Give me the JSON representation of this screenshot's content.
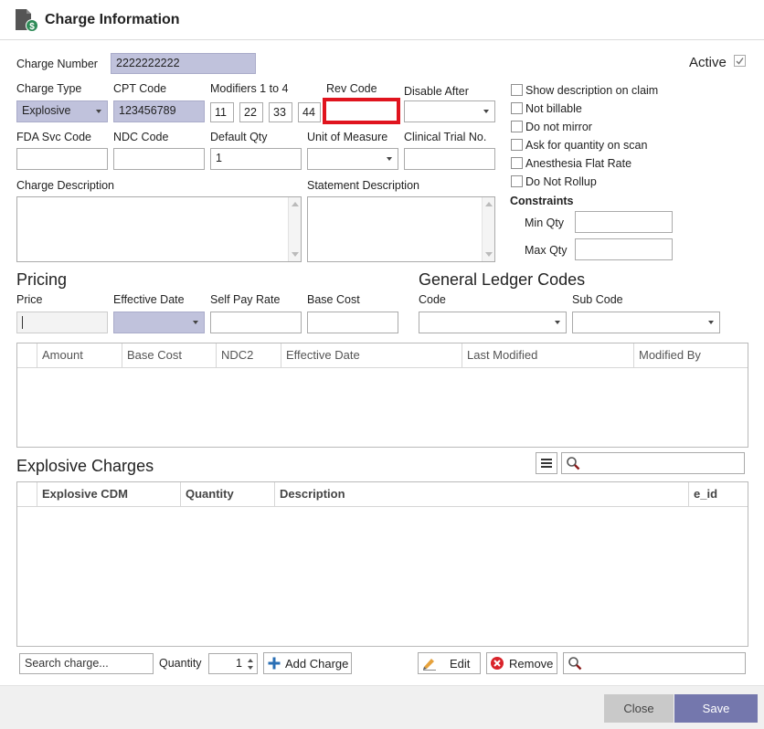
{
  "window": {
    "title": "Charge Information",
    "icon": "document-dollar-icon"
  },
  "active": {
    "label": "Active",
    "checked": true
  },
  "fields": {
    "charge_number": {
      "label": "Charge Number",
      "value": "2222222222"
    },
    "charge_type": {
      "label": "Charge Type",
      "value": "Explosive"
    },
    "cpt_code": {
      "label": "CPT Code",
      "value": "123456789"
    },
    "modifiers": {
      "label": "Modifiers 1 to 4",
      "values": [
        "11",
        "22",
        "33",
        "44"
      ]
    },
    "rev_code": {
      "label": "Rev Code",
      "value": ""
    },
    "disable_after": {
      "label": "Disable After",
      "value": ""
    },
    "fda_svc_code": {
      "label": "FDA Svc Code",
      "value": ""
    },
    "ndc_code": {
      "label": "NDC Code",
      "value": ""
    },
    "default_qty": {
      "label": "Default Qty",
      "value": "1"
    },
    "unit_of_measure": {
      "label": "Unit of Measure",
      "value": ""
    },
    "clinical_trial_no": {
      "label": "Clinical Trial No.",
      "value": ""
    },
    "charge_description": {
      "label": "Charge Description",
      "value": ""
    },
    "statement_description": {
      "label": "Statement Description",
      "value": ""
    }
  },
  "options": [
    {
      "label": "Show description on claim",
      "checked": false
    },
    {
      "label": "Not billable",
      "checked": false
    },
    {
      "label": "Do not mirror",
      "checked": false
    },
    {
      "label": "Ask for quantity on scan",
      "checked": false
    },
    {
      "label": "Anesthesia Flat Rate",
      "checked": false
    },
    {
      "label": "Do Not Rollup",
      "checked": false
    }
  ],
  "constraints": {
    "heading": "Constraints",
    "min_qty_label": "Min Qty",
    "min_qty": "",
    "max_qty_label": "Max Qty",
    "max_qty": ""
  },
  "pricing": {
    "heading": "Pricing",
    "price_label": "Price",
    "price": "",
    "effective_date_label": "Effective Date",
    "effective_date": "",
    "self_pay_rate_label": "Self Pay Rate",
    "self_pay_rate": "",
    "base_cost_label": "Base Cost",
    "base_cost": ""
  },
  "gl_codes": {
    "heading": "General Ledger Codes",
    "code_label": "Code",
    "code": "",
    "sub_code_label": "Sub Code",
    "sub_code": ""
  },
  "price_grid": {
    "columns": [
      "Amount",
      "Base Cost",
      "NDC2",
      "Effective Date",
      "Last Modified",
      "Modified By"
    ],
    "rows": []
  },
  "explosive": {
    "heading": "Explosive Charges",
    "menu_icon": "hamburger-menu-icon",
    "search_value": "",
    "columns": [
      "Explosive CDM",
      "Quantity",
      "Description",
      "e_id"
    ],
    "rows": []
  },
  "toolbar": {
    "search_charge_value": "Search charge...",
    "quantity_label": "Quantity",
    "quantity_value": "1",
    "add_charge_label": "Add Charge",
    "edit_label": "Edit",
    "remove_label": "Remove",
    "search_value": ""
  },
  "footer": {
    "close_label": "Close",
    "save_label": "Save"
  },
  "colors": {
    "readonly_field": "#c0c2dc",
    "highlight": "#e0141e",
    "save_button": "#7477ad",
    "close_button": "#c9c9c9"
  }
}
